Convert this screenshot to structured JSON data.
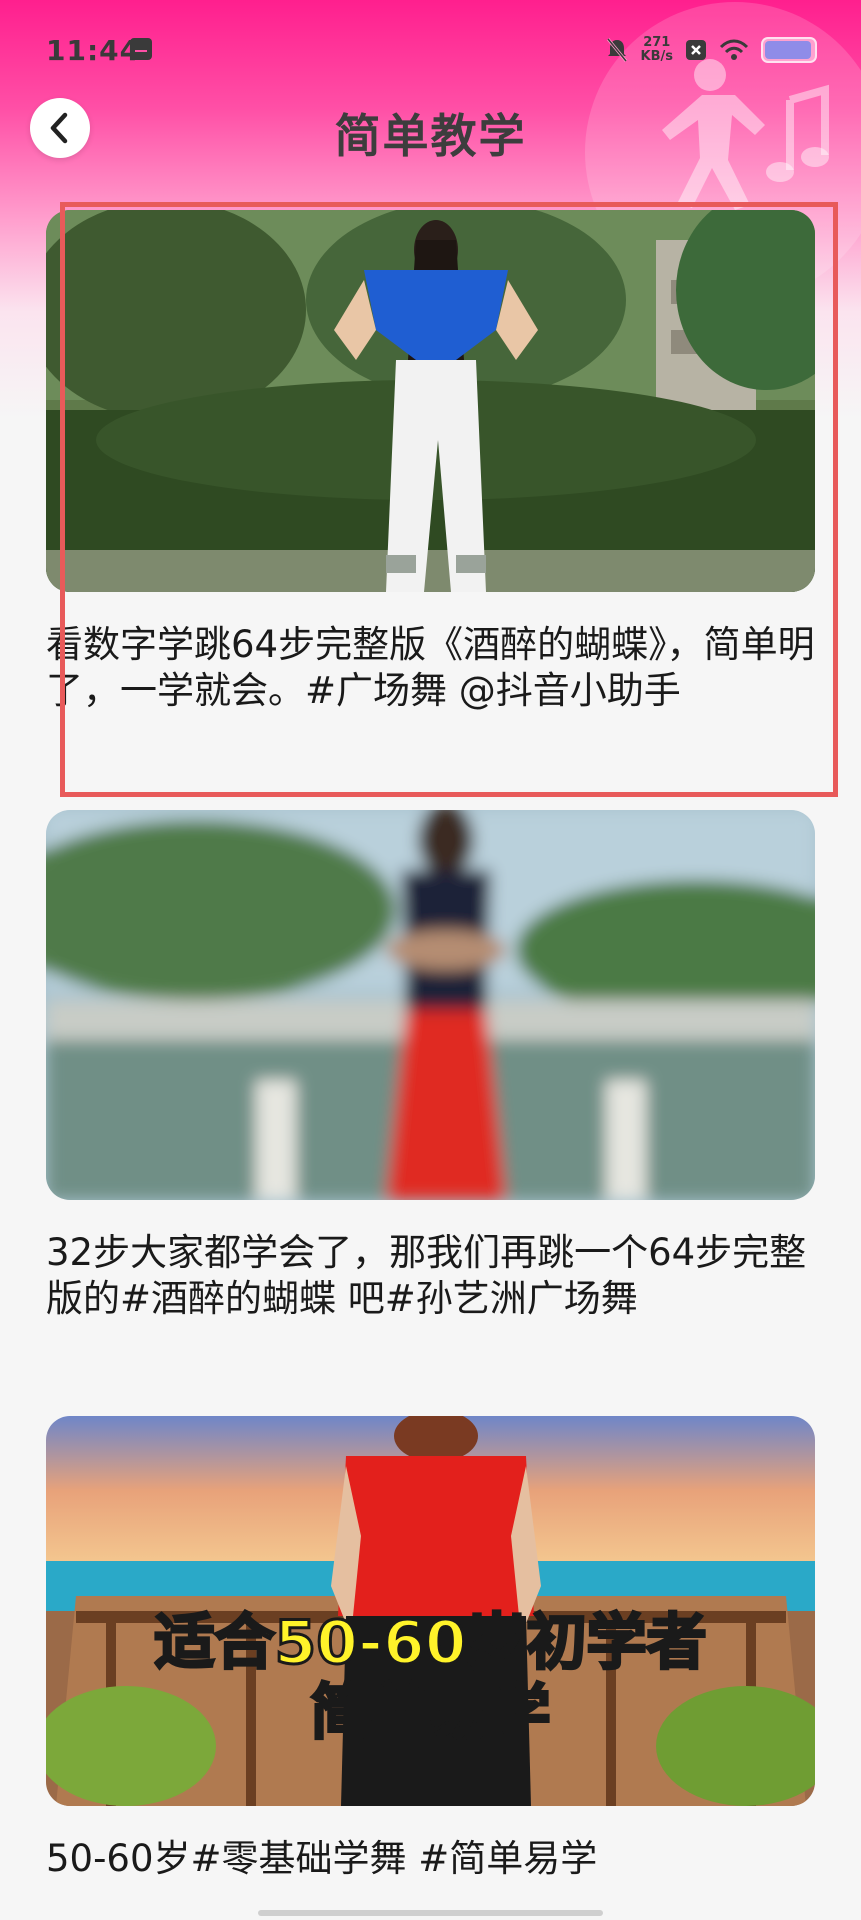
{
  "status_bar": {
    "time": "11:44",
    "speed_value": "271",
    "speed_unit": "KB/s"
  },
  "header": {
    "title": "简单教学",
    "back_icon": "chevron-left-icon"
  },
  "videos": [
    {
      "title": "看数字学跳64步完整版《酒醉的蝴蝶》，简单明了，一学就会。#广场舞 @抖音小助手",
      "thumbnail_overlay": ""
    },
    {
      "title": "32步大家都学会了，那我们再跳一个64步完整版的#酒醉的蝴蝶 吧#孙艺洲广场舞",
      "thumbnail_overlay": ""
    },
    {
      "title": "50-60岁#零基础学舞 #简单易学",
      "thumbnail_overlay_line1": "适合50-60岁初学者",
      "thumbnail_overlay_line2": "简单易学"
    }
  ],
  "colors": {
    "accent_pink": "#ff1f8e",
    "highlight_red": "#e85a5a",
    "title_text": "#3d3d3d"
  }
}
